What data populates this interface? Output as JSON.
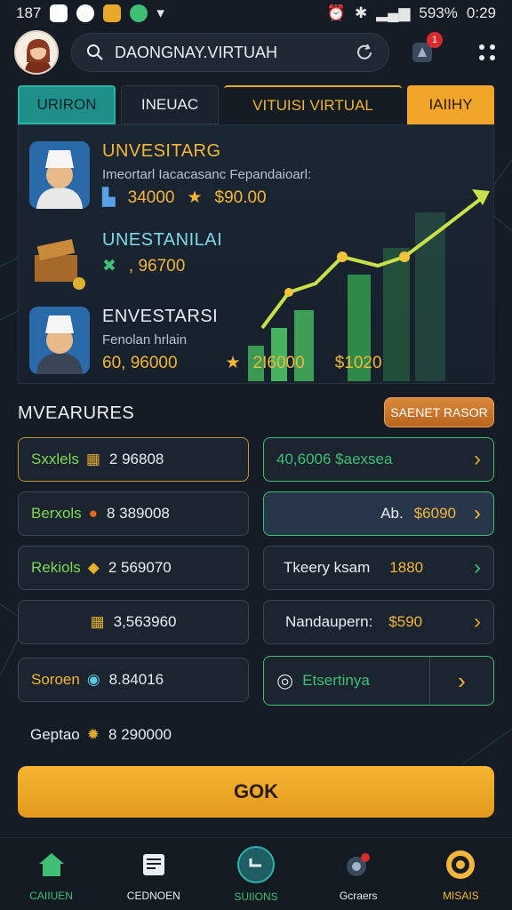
{
  "status": {
    "time_left": "187",
    "battery": "593%",
    "clock": "0:29"
  },
  "search": {
    "value": "DAONGNAY.VIRTUAH"
  },
  "notification": {
    "count": "1"
  },
  "tabs": [
    "URIRON",
    "INEUAC",
    "VITUISI VIRTUAL",
    "IAIIHY"
  ],
  "investments": [
    {
      "title": "UNVESITARG",
      "subtitle": "Imeortarl Iacacasanc Fepandaioarl:",
      "v1": "34000",
      "v1_prefix": ",",
      "v2": "$90.00"
    },
    {
      "title": "UNESTANILAI",
      "subtitle": "",
      "v1": ", 96700",
      "v2": ""
    },
    {
      "title": "ENVESTARSI",
      "subtitle": "Fenolan hrlain",
      "v1": "60, 96000",
      "v2": "2I6000",
      "v3": "$1020"
    }
  ],
  "section": {
    "title": "MVEARURES",
    "button": "SAENET RASOR"
  },
  "left_cards": [
    {
      "label": "Sxxlels",
      "value": "2 96808"
    },
    {
      "label": "Berxols",
      "value": "8 389008"
    },
    {
      "label": "Rekiols",
      "value": "2 569070"
    },
    {
      "label": "",
      "value": "3,563960"
    },
    {
      "label": "Soroen",
      "value": "8.84016"
    },
    {
      "label": "Geptao",
      "value": "8 290000"
    }
  ],
  "right_cards": [
    {
      "label": "40,6006 $aexsea",
      "amount": ""
    },
    {
      "label": "Ab.",
      "amount": "$6090"
    },
    {
      "label": "Tkeery ksam",
      "amount": "1880"
    },
    {
      "label": "Nandaupern:",
      "amount": "$590"
    },
    {
      "label": "Etsertinya",
      "amount": ""
    }
  ],
  "go_button": "GOK",
  "nav": [
    {
      "label": "CAIIUEN",
      "color": "#3fbf73"
    },
    {
      "label": "CEDNOEN",
      "color": "#e8edf3"
    },
    {
      "label": "SUIIONS",
      "color": "#3fbf73"
    },
    {
      "label": "Gcraers",
      "color": "#e8edf3"
    },
    {
      "label": "MISAIS",
      "color": "#f3b63a"
    }
  ]
}
